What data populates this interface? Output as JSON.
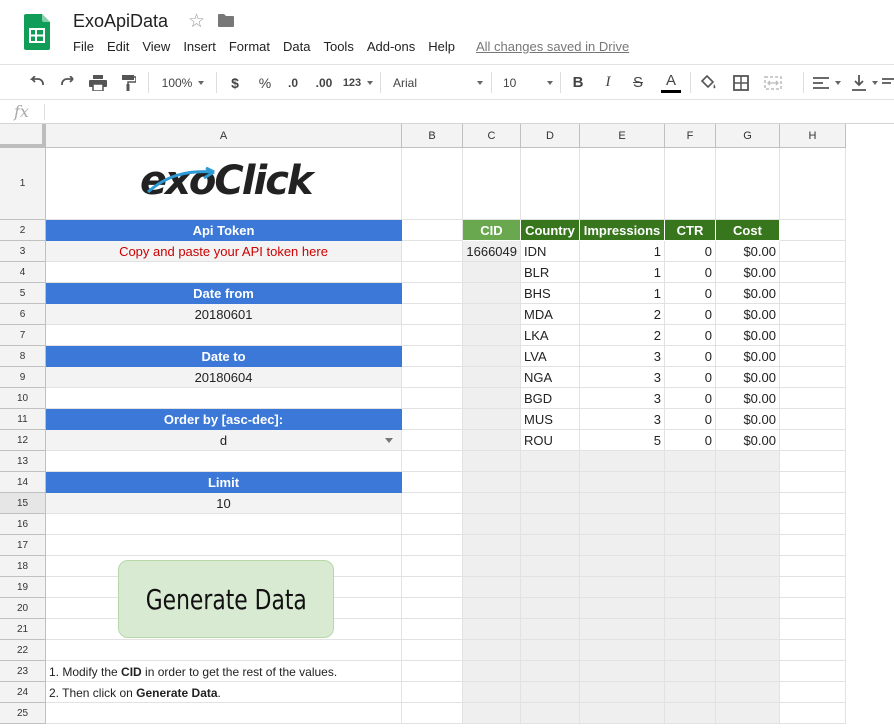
{
  "header": {
    "title": "ExoApiData",
    "star_icon": "star-icon",
    "folder_icon": "folder-icon",
    "menu": [
      "File",
      "Edit",
      "View",
      "Insert",
      "Format",
      "Data",
      "Tools",
      "Add-ons",
      "Help"
    ],
    "save_status": "All changes saved in Drive"
  },
  "toolbar": {
    "zoom": "100%",
    "currency": "$",
    "percent": "%",
    "dec_decrease": ".0",
    "dec_increase": ".00",
    "more_formats": "123",
    "font": "Arial",
    "font_size": "10",
    "bold": "B",
    "italic": "I",
    "strike": "S",
    "text_color": "A",
    "text_color_value": "#000000"
  },
  "formula_bar": {
    "fx": "fx",
    "value": ""
  },
  "columns": [
    "A",
    "B",
    "C",
    "D",
    "E",
    "F",
    "G",
    "H"
  ],
  "rows": [
    "1",
    "2",
    "3",
    "4",
    "5",
    "6",
    "7",
    "8",
    "9",
    "10",
    "11",
    "12",
    "13",
    "14",
    "15",
    "16",
    "17",
    "18",
    "19",
    "20",
    "21",
    "22",
    "23",
    "24",
    "25"
  ],
  "form": {
    "api_token_label": "Api Token",
    "api_token_value": "Copy and paste your API token here",
    "date_from_label": "Date from",
    "date_from_value": "20180601",
    "date_to_label": "Date to",
    "date_to_value": "20180604",
    "order_label": "Order by [asc-dec]:",
    "order_value": "d",
    "limit_label": "Limit",
    "limit_value": "10",
    "button_label": "Generate Data",
    "logo_text_exo": "exo",
    "logo_text_click": "Click"
  },
  "table": {
    "headers": [
      "CID",
      "Country",
      "Impressions",
      "CTR",
      "Cost"
    ],
    "cid": "1666049",
    "rows": [
      [
        "IDN",
        "1",
        "0",
        "$0.00"
      ],
      [
        "BLR",
        "1",
        "0",
        "$0.00"
      ],
      [
        "BHS",
        "1",
        "0",
        "$0.00"
      ],
      [
        "MDA",
        "2",
        "0",
        "$0.00"
      ],
      [
        "LKA",
        "2",
        "0",
        "$0.00"
      ],
      [
        "LVA",
        "3",
        "0",
        "$0.00"
      ],
      [
        "NGA",
        "3",
        "0",
        "$0.00"
      ],
      [
        "BGD",
        "3",
        "0",
        "$0.00"
      ],
      [
        "MUS",
        "3",
        "0",
        "$0.00"
      ],
      [
        "ROU",
        "5",
        "0",
        "$0.00"
      ]
    ]
  },
  "notes": {
    "line1_pre": "1. Modify the ",
    "line1_bold": "CID",
    "line1_post": " in order to get the rest of the values.",
    "line2_pre": "2. Then click on ",
    "line2_bold": "Generate Data",
    "line2_post": "."
  },
  "colors": {
    "header_blue": "#3c78d8",
    "header_green": "#6aa84f",
    "header_dark_green": "#38761d",
    "button_green": "#d9ead3",
    "token_red": "#cc0000"
  }
}
